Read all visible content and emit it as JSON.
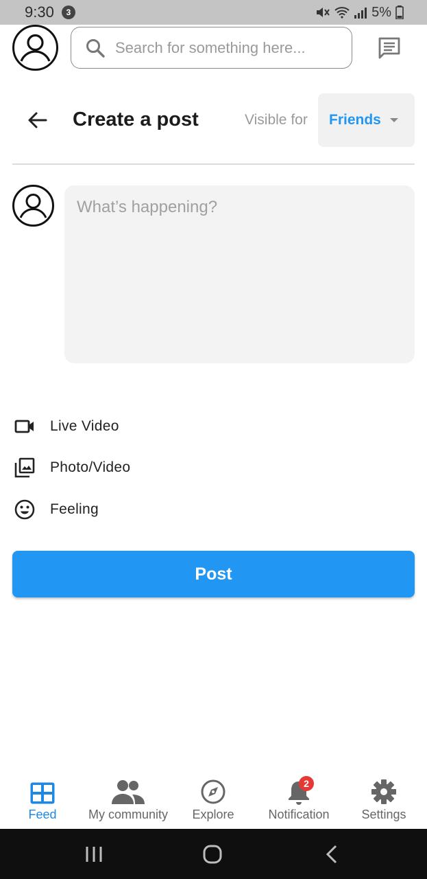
{
  "status_bar": {
    "time": "9:30",
    "notification_count": "3",
    "battery": "5%"
  },
  "top_bar": {
    "search_placeholder": "Search for something here..."
  },
  "header": {
    "title": "Create a post",
    "visible_for_label": "Visible for",
    "visibility_value": "Friends"
  },
  "composer": {
    "placeholder": "What’s happening?"
  },
  "options": [
    {
      "label": "Live Video",
      "icon": "video-camera-icon"
    },
    {
      "label": "Photo/Video",
      "icon": "photo-library-icon"
    },
    {
      "label": "Feeling",
      "icon": "smiley-icon"
    }
  ],
  "post_button": {
    "label": "Post",
    "color": "#2196f3"
  },
  "bottom_nav": {
    "items": [
      {
        "label": "Feed",
        "icon": "grid-icon",
        "active": true
      },
      {
        "label": "My community",
        "icon": "people-icon",
        "active": false
      },
      {
        "label": "Explore",
        "icon": "compass-icon",
        "active": false
      },
      {
        "label": "Notification",
        "icon": "bell-icon",
        "active": false,
        "badge": "2"
      },
      {
        "label": "Settings",
        "icon": "gear-icon",
        "active": false
      }
    ]
  },
  "colors": {
    "accent": "#2196f3",
    "badge": "#e53935",
    "status_bar": "#c4c4c4"
  }
}
